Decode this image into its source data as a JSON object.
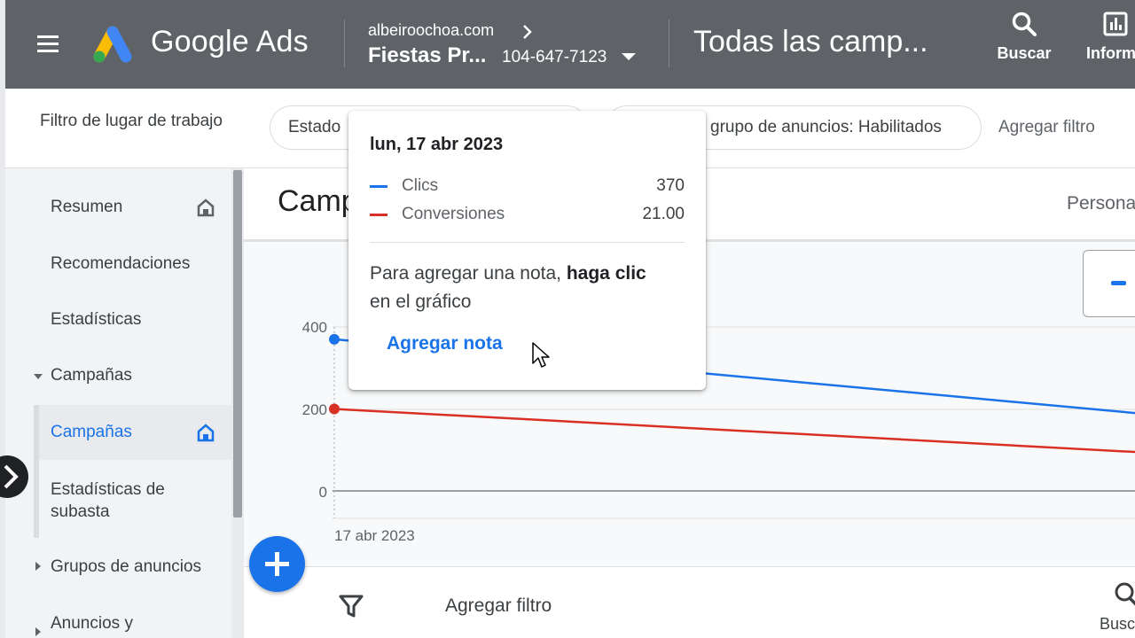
{
  "header": {
    "logo_text": "Google Ads",
    "account_domain": "albeiroochoa.com",
    "account_name": "Fiestas Pr...",
    "account_id": "104-647-7123",
    "page_title": "Todas las camp...",
    "search_label": "Buscar",
    "reports_label": "Informe"
  },
  "filterbar": {
    "workspace_label": "Filtro de lugar de trabajo",
    "chips": [
      "Estado",
      "grupo de anuncios: Habilitados"
    ],
    "add_filter": "Agregar filtro"
  },
  "sidebar": {
    "items": [
      {
        "label": "Resumen"
      },
      {
        "label": "Recomendaciones"
      },
      {
        "label": "Estadísticas"
      },
      {
        "label": "Campañas"
      },
      {
        "label": "Campañas"
      },
      {
        "label": "Estadísticas de subasta"
      },
      {
        "label": "Grupos de anuncios"
      },
      {
        "label": "Anuncios y"
      }
    ]
  },
  "main": {
    "title": "Camp",
    "customize": "Persona"
  },
  "chart_data": {
    "type": "line",
    "x": [
      "17 abr 2023"
    ],
    "xlabel": "",
    "ylabel": "",
    "ylim": [
      0,
      400
    ],
    "yticks": [
      "0",
      "200",
      "400"
    ],
    "series": [
      {
        "name": "Clics",
        "color": "#1a73e8",
        "values": [
          370
        ],
        "end_value": 190
      },
      {
        "name": "Conversiones",
        "color": "#d93025",
        "values": [
          200
        ],
        "end_value": 95
      }
    ]
  },
  "tooltip": {
    "date": "lun, 17 abr 2023",
    "rows": [
      {
        "name": "Clics",
        "value": "370",
        "color": "#1a73e8"
      },
      {
        "name": "Conversiones",
        "value": "21.00",
        "color": "#d93025"
      }
    ],
    "note_prefix": "Para agregar una nota,",
    "note_bold": "haga clic",
    "note_suffix": "en el gráfico",
    "link": "Agregar nota"
  },
  "bottom": {
    "add_filter": "Agregar filtro",
    "search_label": "Busc"
  },
  "colors": {
    "header_bg": "#5f6368",
    "accent": "#1a73e8",
    "conversions": "#d93025"
  }
}
